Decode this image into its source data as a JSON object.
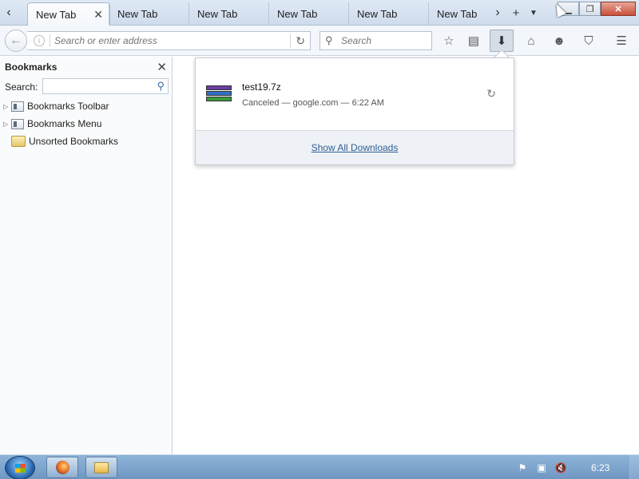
{
  "tabs": [
    {
      "label": "New Tab",
      "active": true
    },
    {
      "label": "New Tab",
      "active": false
    },
    {
      "label": "New Tab",
      "active": false
    },
    {
      "label": "New Tab",
      "active": false
    },
    {
      "label": "New Tab",
      "active": false
    },
    {
      "label": "New Tab",
      "active": false
    }
  ],
  "toolbar": {
    "url_placeholder": "Search or enter address",
    "search_placeholder": "Search"
  },
  "sidebar": {
    "title": "Bookmarks",
    "search_label": "Search:",
    "items": [
      {
        "label": "Bookmarks Toolbar"
      },
      {
        "label": "Bookmarks Menu"
      },
      {
        "label": "Unsorted Bookmarks"
      }
    ]
  },
  "downloads": {
    "items": [
      {
        "name": "test19.7z",
        "status": "Canceled — google.com — 6:22 AM"
      }
    ],
    "show_all": "Show All Downloads"
  },
  "taskbar": {
    "clock": "6:23"
  },
  "colors": {
    "link": "#2f5f95",
    "taskbar": "#6f97c2",
    "close_button": "#c9503a"
  }
}
